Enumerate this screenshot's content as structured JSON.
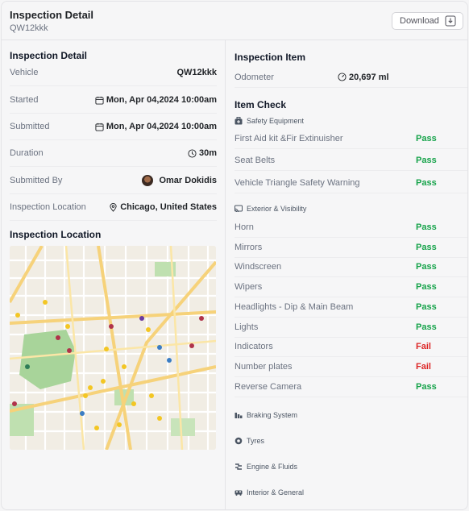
{
  "header": {
    "title": "Inspection Detail",
    "subtitle": "QW12kkk",
    "download_label": "Download"
  },
  "details": {
    "title": "Inspection Detail",
    "rows": [
      {
        "label": "Vehicle",
        "value": "QW12kkk",
        "icon": "none"
      },
      {
        "label": "Started",
        "value": "Mon, Apr 04,2024 10:00am",
        "icon": "calendar-icon"
      },
      {
        "label": "Submitted",
        "value": "Mon, Apr 04,2024 10:00am",
        "icon": "calendar-icon"
      },
      {
        "label": "Duration",
        "value": "30m",
        "icon": "clock-icon"
      },
      {
        "label": "Submitted By",
        "value": "Omar Dokidis",
        "icon": "avatar"
      },
      {
        "label": "Inspection Location",
        "value": "Chicago, United States",
        "icon": "location-pin-icon"
      }
    ]
  },
  "location": {
    "title": "Inspection Location"
  },
  "inspection_item": {
    "title": "Inspection Item",
    "odometer_label": "Odometer",
    "odometer_value": "20,697 ml"
  },
  "item_check": {
    "title": "Item Check",
    "categories": [
      {
        "name": "Safety Equipment",
        "icon": "first-aid-icon"
      },
      {
        "name": "Exterior & Visibility",
        "icon": "cast-icon"
      },
      {
        "name": "Braking System",
        "icon": "brake-icon"
      },
      {
        "name": "Tyres",
        "icon": "tyre-icon"
      },
      {
        "name": "Engine & Fluids",
        "icon": "engine-icon"
      },
      {
        "name": "Interior & General",
        "icon": "car-interior-icon"
      }
    ],
    "safety_items": [
      {
        "label": "First Aid kit &Fir Extinuisher",
        "result": "Pass"
      },
      {
        "label": "Seat Belts",
        "result": "Pass"
      },
      {
        "label": "Vehicle Triangle Safety Warning",
        "result": "Pass"
      }
    ],
    "exterior_items": [
      {
        "label": "Horn",
        "result": "Pass"
      },
      {
        "label": "Mirrors",
        "result": "Pass"
      },
      {
        "label": "Windscreen",
        "result": "Pass"
      },
      {
        "label": "Wipers",
        "result": "Pass"
      },
      {
        "label": "Headlights - Dip & Main Beam",
        "result": "Pass"
      },
      {
        "label": "Lights",
        "result": "Pass"
      },
      {
        "label": "Indicators",
        "result": "Fail"
      },
      {
        "label": "Number plates",
        "result": "Fail"
      },
      {
        "label": "Reverse Camera",
        "result": "Pass"
      }
    ]
  },
  "colors": {
    "pass": "#16a34a",
    "fail": "#dc2626",
    "map_park": "#a8d49a",
    "map_road": "#f6d27a"
  }
}
